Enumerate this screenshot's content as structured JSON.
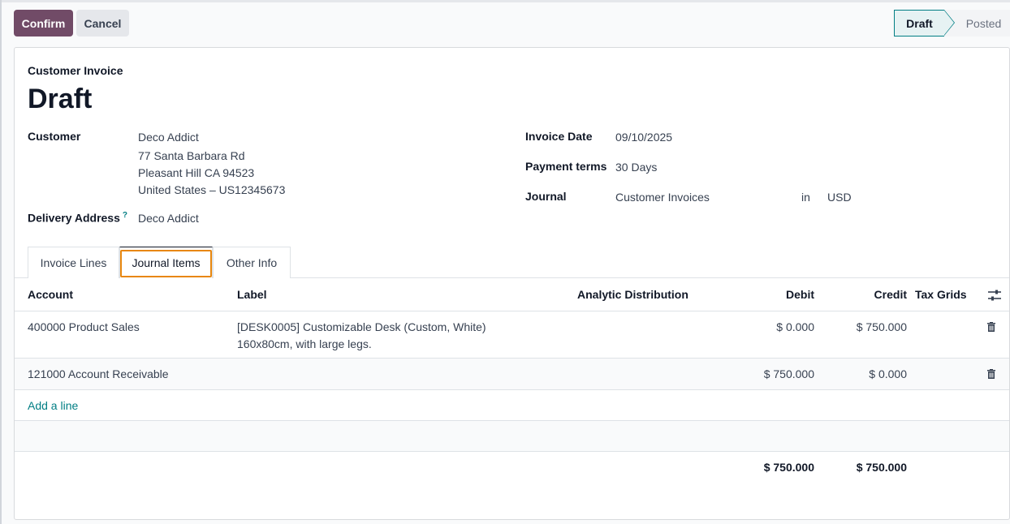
{
  "buttons": {
    "confirm": "Confirm",
    "cancel": "Cancel"
  },
  "status": {
    "stages": [
      "Draft",
      "Posted"
    ],
    "current": "Draft"
  },
  "invoice": {
    "type": "Customer Invoice",
    "name": "Draft",
    "customer_label": "Customer",
    "customer_name": "Deco Addict",
    "address_line1": "77 Santa Barbara Rd",
    "address_line2": "Pleasant Hill CA 94523",
    "address_line3": "United States – US12345673",
    "delivery_label": "Delivery Address",
    "delivery_help": "?",
    "delivery_value": "Deco Addict",
    "invoice_date_label": "Invoice Date",
    "invoice_date": "09/10/2025",
    "payment_terms_label": "Payment terms",
    "payment_terms": "30 Days",
    "journal_label": "Journal",
    "journal": "Customer Invoices",
    "in_label": "in",
    "currency": "USD"
  },
  "tabs": [
    {
      "label": "Invoice Lines"
    },
    {
      "label": "Journal Items",
      "active": true
    },
    {
      "label": "Other Info"
    }
  ],
  "table": {
    "headers": {
      "account": "Account",
      "label": "Label",
      "analytic": "Analytic Distribution",
      "debit": "Debit",
      "credit": "Credit",
      "tax_grids": "Tax Grids"
    },
    "rows": [
      {
        "account": "400000 Product Sales",
        "label_line1": "[DESK0005] Customizable Desk (Custom, White)",
        "label_line2": "160x80cm, with large legs.",
        "debit": "$ 0.000",
        "credit": "$ 750.000"
      },
      {
        "account": "121000 Account Receivable",
        "debit": "$ 750.000",
        "credit": "$ 0.000"
      }
    ],
    "add_line": "Add a line",
    "total_debit": "$ 750.000",
    "total_credit": "$ 750.000"
  },
  "icons": {
    "column_settings": "sliders-icon",
    "delete": "trash-icon"
  },
  "colors": {
    "primary": "#714b67",
    "teal": "#017e84",
    "highlight": "#e8870e"
  }
}
